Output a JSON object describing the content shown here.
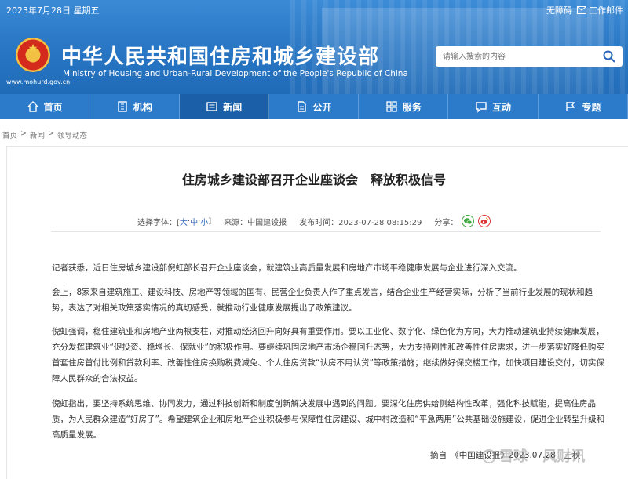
{
  "header": {
    "date": "2023年7月28日 星期五",
    "accessibility": "无障碍",
    "work_portal": "工作邮件",
    "site_title": "中华人民共和国住房和城乡建设部",
    "site_title_en": "Ministry of Housing and Urban-Rural Development of the People's Republic of China",
    "site_url": "www.mohurd.gov.cn",
    "search_placeholder": "请输入搜索的内容"
  },
  "nav": [
    {
      "label": "首页",
      "icon": "home-icon"
    },
    {
      "label": "机构",
      "icon": "building-icon"
    },
    {
      "label": "新闻",
      "icon": "news-icon",
      "active": true
    },
    {
      "label": "公开",
      "icon": "document-icon"
    },
    {
      "label": "服务",
      "icon": "service-icon"
    },
    {
      "label": "互动",
      "icon": "chat-icon"
    },
    {
      "label": "专题",
      "icon": "flag-icon"
    }
  ],
  "breadcrumb": [
    "首页",
    "新闻",
    "领导动态"
  ],
  "breadcrumb_sep": ">",
  "article": {
    "title": "住房城乡建设部召开企业座谈会　释放积极信号",
    "font_label": "选择字体：[",
    "font_large": "大",
    "font_mid": "中",
    "font_small": "小",
    "font_close": "]",
    "font_dot": "·",
    "source": "来源：中国建设报",
    "published": "发布时间：2023-07-28 08:15:29",
    "share_label": "分享：",
    "paragraphs": [
      "记者获悉，近日住房城乡建设部倪虹部长召开企业座谈会，就建筑业高质量发展和房地产市场平稳健康发展与企业进行深入交流。",
      "会上，8家来自建筑施工、建设科技、房地产等领域的国有、民营企业负责人作了重点发言，结合企业生产经营实际，分析了当前行业发展的现状和趋势，表达了对相关政策落实情况的真切感受，就推动行业健康发展提出了政策建议。",
      "倪虹强调，稳住建筑业和房地产业两根支柱，对推动经济回升向好具有重要作用。要以工业化、数字化、绿色化为方向，大力推动建筑业持续健康发展，充分发挥建筑业“促投资、稳增长、保就业”的积极作用。要继续巩固房地产市场企稳回升态势，大力支持刚性和改善性住房需求，进一步落实好降低购买首套住房首付比例和贷款利率、改善性住房换购税费减免、个人住房贷款“认房不用认贷”等政策措施；继续做好保交楼工作，加快项目建设交付，切实保障人民群众的合法权益。",
      "倪虹指出，要坚持系统思维、协同发力，通过科技创新和制度创新解决发展中遇到的问题。要深化住房供给侧结构性改革，强化科技赋能，提高住房品质，为人民群众建造“好房子”。希望建筑企业和房地产企业积极参与保障性住房建设、城中村改造和“平急两用”公共基础设施建设，促进企业转型升级和高质量发展。"
    ],
    "excerpt": "摘自　《中国建设报》2023.07.28　王秋"
  },
  "watermark": "雪球 · 风财讯"
}
